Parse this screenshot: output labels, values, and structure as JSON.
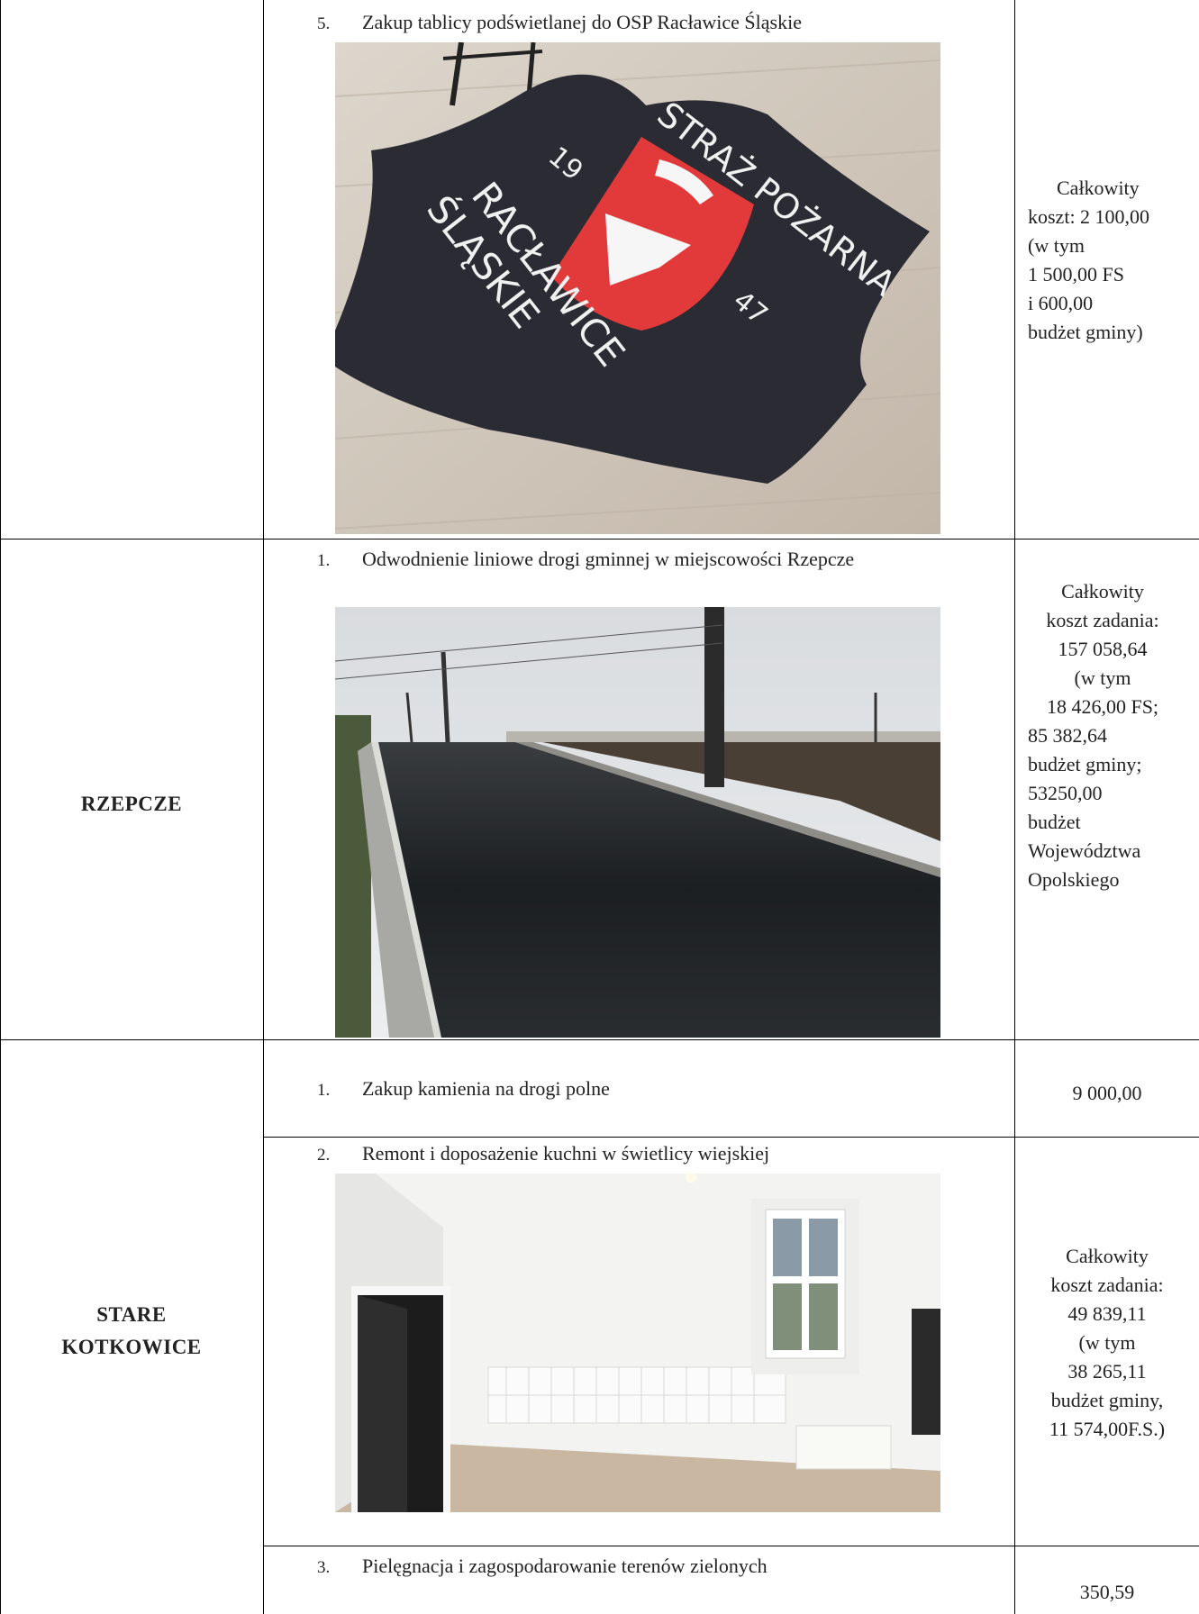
{
  "rows": [
    {
      "locality": "",
      "item": {
        "num": "5.",
        "text": "Zakup tablicy podświetlanej do OSP Racławice Śląskie"
      },
      "sign": {
        "top_text": "STRAŻ POŻARNA",
        "left_text": "RACŁAWICE",
        "left_text2": "ŚLĄSKIE",
        "year_a": "19",
        "year_b": "47"
      },
      "cost": [
        "Całkowity",
        "koszt: 2 100,00",
        "(w tym",
        "1 500,00 FS",
        "i 600,00",
        "budżet gminy)"
      ]
    },
    {
      "locality": "RZEPCZE",
      "item": {
        "num": "1.",
        "text": "Odwodnienie liniowe drogi gminnej w miejscowości Rzepcze"
      },
      "cost": [
        "Całkowity",
        "koszt zadania:",
        "157 058,64",
        "(w tym",
        "18 426,00 FS;",
        "85 382,64",
        "budżet gminy;",
        "53250,00",
        "budżet",
        "Województwa",
        "Opolskiego"
      ]
    },
    {
      "locality_lines": [
        "STARE",
        "KOTKOWICE"
      ],
      "items": [
        {
          "num": "1.",
          "text": "Zakup kamienia na drogi polne",
          "cost": [
            "9 000,00"
          ]
        },
        {
          "num": "2.",
          "text": "Remont i doposażenie kuchni w świetlicy wiejskiej",
          "cost": [
            "Całkowity",
            "koszt zadania:",
            "49 839,11",
            "(w tym",
            "38 265,11",
            "budżet gminy,",
            "11 574,00F.S.)"
          ]
        },
        {
          "num": "3.",
          "text": "Pielęgnacja i zagospodarowanie terenów zielonych",
          "cost": [
            "350,59"
          ]
        }
      ]
    }
  ],
  "colors": {
    "border": "#000000",
    "sign_red": "#e23a3a",
    "sign_dark": "#2a2b33",
    "floor": "#cfc6bb"
  }
}
